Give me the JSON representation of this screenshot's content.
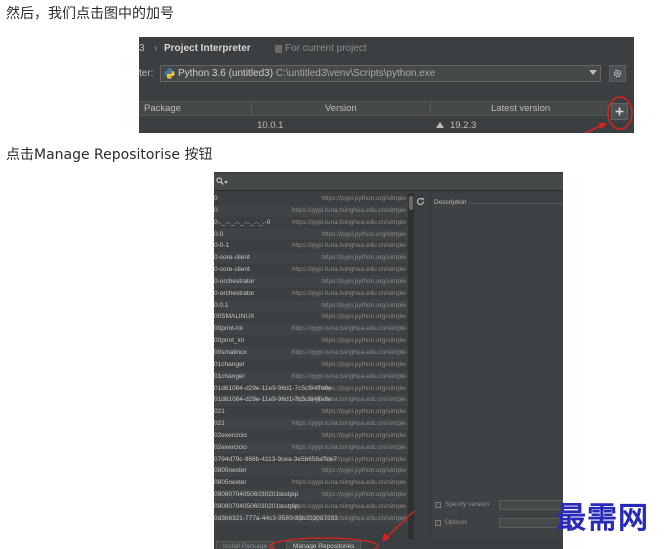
{
  "article": {
    "line1": "然后，我们点击图中的加号",
    "line2": "点击Manage Repositorise 按钮"
  },
  "interpreter_dialog": {
    "crumb_prefix": "3",
    "crumb_separator": "›",
    "crumb_title": "Project Interpreter",
    "crumb_scope": "For current project",
    "interpreter_label": "ter:",
    "interpreter_name": "Python 3.6 (untitled3)",
    "interpreter_path": " C:\\untitled3\\venv\\Scripts\\python.exe",
    "columns": {
      "package": "Package",
      "version": "Version",
      "latest": "Latest version"
    },
    "row": {
      "version": "10.0.1",
      "latest": "19.2.3"
    },
    "add_button_symbol": "+",
    "icons": {
      "interpreter": "python-icon",
      "settings": "gear-icon",
      "add": "plus-icon",
      "upgrade": "up-arrow-icon"
    },
    "annotation_color": "#e02020"
  },
  "available_packages": {
    "packages": [
      {
        "name": "0",
        "repo": "https://pypi.python.org/simple"
      },
      {
        "name": "0",
        "repo": "https://pypi.tuna.tsinghua.edu.cn/simple"
      },
      {
        "name": "0-._.-._.-._.-._.-._.-0",
        "repo": "https://pypi.tuna.tsinghua.edu.cn/simple"
      },
      {
        "name": "0-0",
        "repo": "https://pypi.python.org/simple"
      },
      {
        "name": "0-0-1",
        "repo": "https://pypi.tuna.tsinghua.edu.cn/simple"
      },
      {
        "name": "0-core-client",
        "repo": "https://pypi.python.org/simple"
      },
      {
        "name": "0-core-client",
        "repo": "https://pypi.tuna.tsinghua.edu.cn/simple"
      },
      {
        "name": "0-orchestrator",
        "repo": "https://pypi.python.org/simple"
      },
      {
        "name": "0-orchestrator",
        "repo": "https://pypi.tuna.tsinghua.edu.cn/simple"
      },
      {
        "name": "0.0.1",
        "repo": "https://pypi.python.org/simple"
      },
      {
        "name": "00SMALINUX",
        "repo": "https://pypi.python.org/simple"
      },
      {
        "name": "00print-lol",
        "repo": "https://pypi.tuna.tsinghua.edu.cn/simple"
      },
      {
        "name": "00print_lol",
        "repo": "https://pypi.python.org/simple"
      },
      {
        "name": "00smalinux",
        "repo": "https://pypi.tuna.tsinghua.edu.cn/simple"
      },
      {
        "name": "01changer",
        "repo": "https://pypi.python.org/simple"
      },
      {
        "name": "01changer",
        "repo": "https://pypi.tuna.tsinghua.edu.cn/simple"
      },
      {
        "name": "01d61084-d29e-11e9-96d1-7c5cf84ffe8e",
        "repo": "https://pypi.python.org/simple"
      },
      {
        "name": "01d61084-d29e-11e9-96d1-7c5cf84ffe8e",
        "repo": "https://pypi.tuna.tsinghua.edu.cn/simple"
      },
      {
        "name": "021",
        "repo": "https://pypi.python.org/simple"
      },
      {
        "name": "021",
        "repo": "https://pypi.tuna.tsinghua.edu.cn/simple"
      },
      {
        "name": "02exercicio",
        "repo": "https://pypi.python.org/simple"
      },
      {
        "name": "02exercicio",
        "repo": "https://pypi.tuna.tsinghua.edu.cn/simple"
      },
      {
        "name": "0794d79c-966b-4113-9cea-3e5b658a7de7",
        "repo": "https://pypi.python.org/simple"
      },
      {
        "name": "0805nexter",
        "repo": "https://pypi.python.org/simple"
      },
      {
        "name": "0805nexter",
        "repo": "https://pypi.tuna.tsinghua.edu.cn/simple"
      },
      {
        "name": "090807040506030201testpip",
        "repo": "https://pypi.python.org/simple"
      },
      {
        "name": "090807040506030201testpip",
        "repo": "https://pypi.tuna.tsinghua.edu.cn/simple"
      },
      {
        "name": "0d3b6321-777a-44c3-9580-33b223087233",
        "repo": "https://pypi.tuna.tsinghua.edu.cn/simple"
      },
      {
        "name": "",
        "repo": ""
      }
    ],
    "description_label": "Description",
    "specify_version_label": "Specify version",
    "options_label": "Options",
    "install_button": "Install Package",
    "manage_button": "Manage Repositories",
    "icons": {
      "search": "search-icon",
      "refresh": "refresh-icon"
    },
    "annotation_color": "#e02020"
  },
  "watermark": {
    "text": "最需网",
    "color": "#2a2ab8"
  }
}
